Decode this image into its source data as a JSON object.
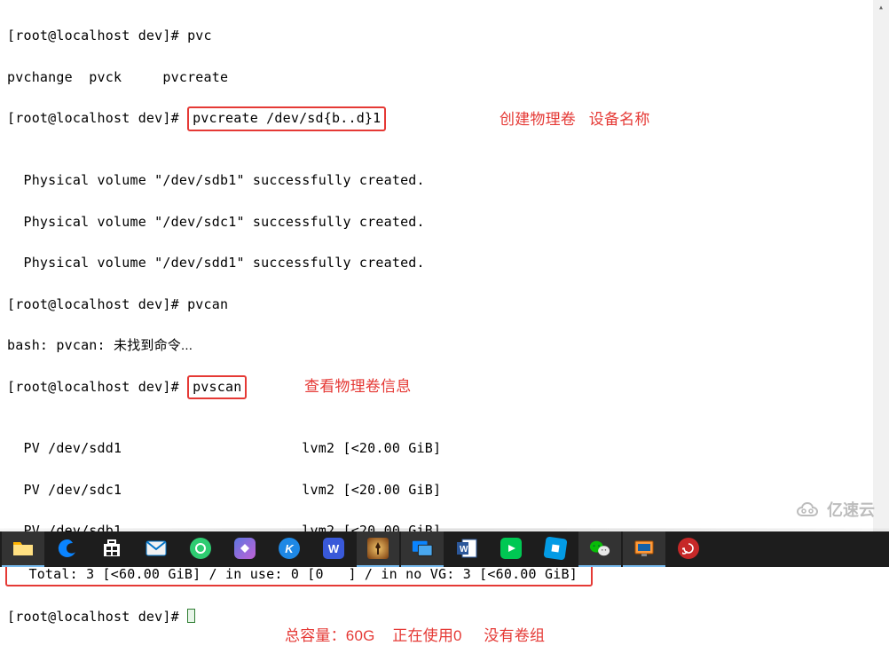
{
  "prompt": "[root@localhost dev]# ",
  "lines": {
    "l1_cmd": "pvc",
    "l2": "pvchange  pvck     pvcreate",
    "l3_cmd_boxed": "pvcreate /dev/sd{b..d}1",
    "l4": "  Physical volume \"/dev/sdb1\" successfully created.",
    "l5": "  Physical volume \"/dev/sdc1\" successfully created.",
    "l6": "  Physical volume \"/dev/sdd1\" successfully created.",
    "l7_cmd": "pvcan",
    "l8_pre": "bash: pvcan: ",
    "l8_cn": "未找到命令...",
    "l9_cmd_boxed": "pvscan",
    "l10": "  PV /dev/sdd1                      lvm2 [<20.00 GiB]",
    "l11": "  PV /dev/sdc1                      lvm2 [<20.00 GiB]",
    "l12": "  PV /dev/sdb1                      lvm2 [<20.00 GiB]",
    "l13_boxed": "  Total: 3 [<60.00 GiB] / in use: 0 [0   ] / in no VG: 3 [<60.00 GiB] "
  },
  "annotations": {
    "a1_left": "创建物理卷",
    "a1_right": "设备名称",
    "a2": "查看物理卷信息",
    "a3_left": "总容量：60G",
    "a3_mid": "正在使用0",
    "a3_right": "没有卷组"
  },
  "watermark_text": "亿速云",
  "taskbar": {
    "items": [
      {
        "name": "file-explorer-icon",
        "bg": "#ffcf48",
        "initial": ""
      },
      {
        "name": "edge-browser-icon",
        "bg": "transparent",
        "initial": ""
      },
      {
        "name": "microsoft-store-icon",
        "bg": "transparent",
        "initial": ""
      },
      {
        "name": "mail-icon",
        "bg": "#0072c6",
        "initial": ""
      },
      {
        "name": "360-browser-icon",
        "bg": "#2ecc71",
        "initial": ""
      },
      {
        "name": "app-pink-icon",
        "bg": "#7b4ba0",
        "initial": ""
      },
      {
        "name": "kugou-icon",
        "bg": "#1e88e5",
        "initial": "K"
      },
      {
        "name": "wps-icon",
        "bg": "#2962ff",
        "initial": "W"
      },
      {
        "name": "game-icon",
        "bg": "#c67b2d",
        "initial": ""
      },
      {
        "name": "remote-desktop-icon",
        "bg": "#0a84ff",
        "initial": ""
      },
      {
        "name": "word-icon",
        "bg": "#2b579a",
        "initial": ""
      },
      {
        "name": "iqiyi-icon",
        "bg": "#00c853",
        "initial": ""
      },
      {
        "name": "app-blue-icon",
        "bg": "#039be5",
        "initial": ""
      },
      {
        "name": "wechat-icon",
        "bg": "#09bb07",
        "initial": ""
      },
      {
        "name": "virtualbox-icon",
        "bg": "#ff7600",
        "initial": ""
      },
      {
        "name": "spiral-icon",
        "bg": "#c62828",
        "initial": ""
      }
    ]
  }
}
